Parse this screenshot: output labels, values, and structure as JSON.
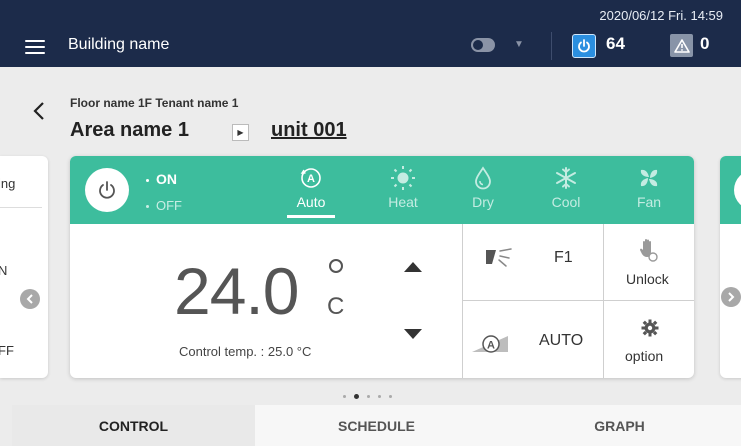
{
  "header": {
    "datetime": "2020/06/12 Fri. 14:59",
    "building_name": "Building name",
    "on_count": "64",
    "warning_count": "0"
  },
  "location": {
    "subtitle": "Floor name 1F Tenant name 1",
    "area_name": "Area name 1",
    "unit_name": "unit 001"
  },
  "left_card": {
    "partial_text_top": "ing",
    "partial_on": "N",
    "partial_off": "FF"
  },
  "power": {
    "on_label": "ON",
    "off_label": "OFF",
    "state": "on"
  },
  "modes": [
    {
      "label": "Auto",
      "icon": "auto-icon",
      "active": true
    },
    {
      "label": "Heat",
      "icon": "sun-icon",
      "active": false
    },
    {
      "label": "Dry",
      "icon": "droplet-icon",
      "active": false
    },
    {
      "label": "Cool",
      "icon": "snowflake-icon",
      "active": false
    },
    {
      "label": "Fan",
      "icon": "fan-icon",
      "active": false
    }
  ],
  "temperature": {
    "setpoint": "24.0",
    "unit": "C",
    "control_temp_text": "Control temp. : 25.0 °C"
  },
  "controls": {
    "airflow_label": "F1",
    "lock_label": "Unlock",
    "fan_speed_label": "AUTO",
    "option_label": "option"
  },
  "pager": {
    "count": 5,
    "active": 1
  },
  "tabs": [
    {
      "label": "CONTROL",
      "active": true
    },
    {
      "label": "SCHEDULE",
      "active": false
    },
    {
      "label": "GRAPH",
      "active": false
    }
  ],
  "colors": {
    "topbar": "#1c2b4a",
    "accent_green": "#3dbd9d",
    "power_badge": "#2b8fe0"
  }
}
